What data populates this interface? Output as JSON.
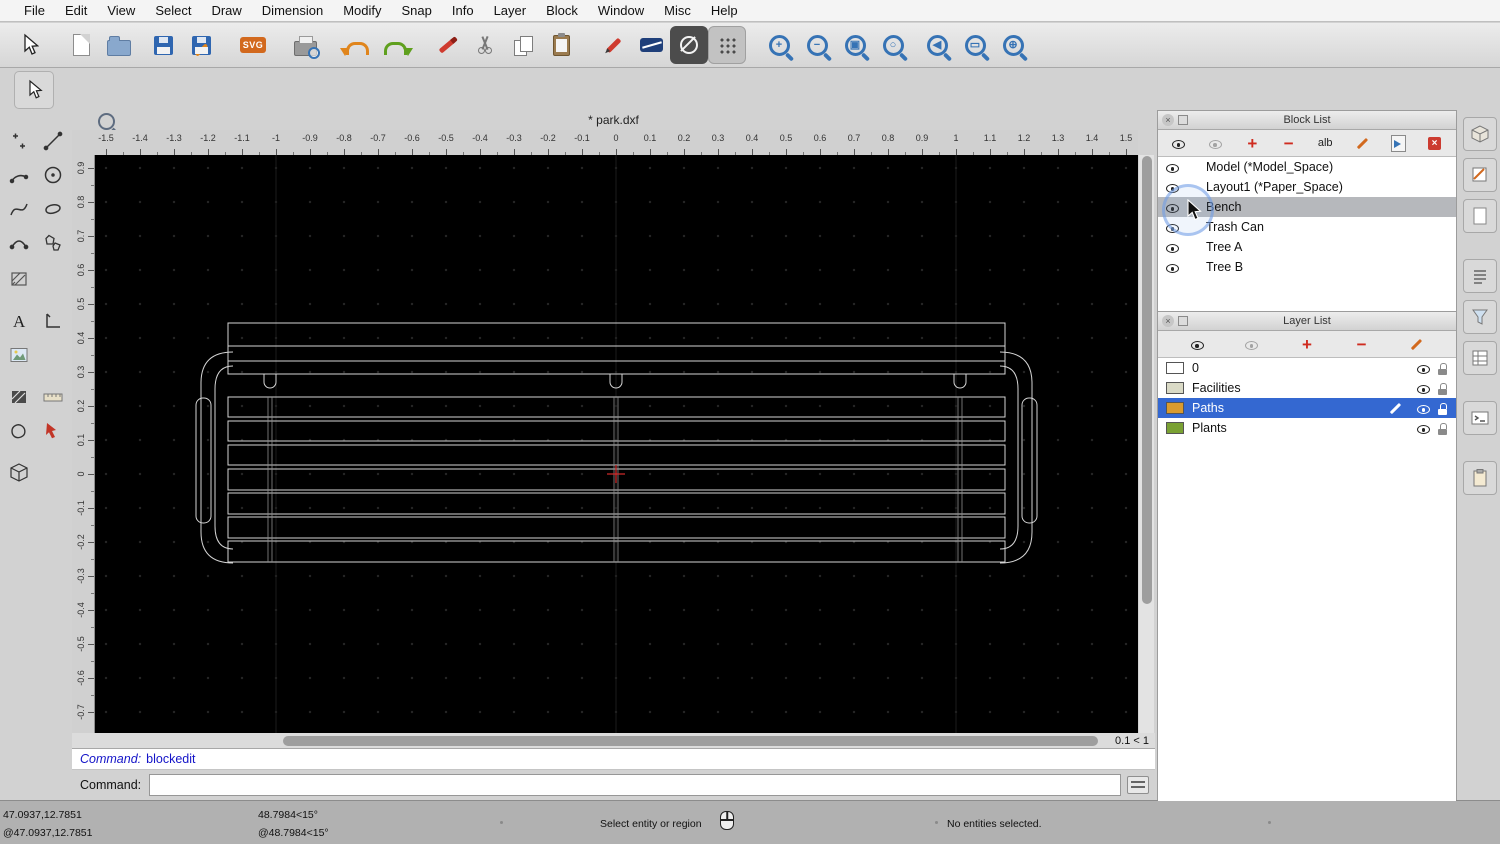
{
  "menu": {
    "items": [
      "File",
      "Edit",
      "View",
      "Select",
      "Draw",
      "Dimension",
      "Modify",
      "Snap",
      "Info",
      "Layer",
      "Block",
      "Window",
      "Misc",
      "Help"
    ]
  },
  "document": {
    "title": "* park.dxf"
  },
  "toolbar": {
    "icons": [
      "select-cursor",
      "new-file",
      "open-file",
      "save",
      "save-as",
      "svg-export",
      "print-preview",
      "undo",
      "redo",
      "erase",
      "cut",
      "copy",
      "paste",
      "pen-edit",
      "attributes",
      "draw-donut",
      "grid-toggle",
      "zoom-in",
      "zoom-out",
      "zoom-auto",
      "zoom-redraw",
      "zoom-previous",
      "zoom-window",
      "zoom-pan"
    ],
    "svg_icon_text": "SVG"
  },
  "left_palette": {
    "tools": [
      "points",
      "line",
      "arc",
      "circle",
      "spline",
      "ellipse",
      "polyline",
      "polygon",
      "hatch",
      "text",
      "dimension",
      "image",
      "pattern",
      "measure",
      "shape",
      "modify",
      "solid"
    ]
  },
  "canvas": {
    "h_ruler_labels": [
      "-1.5",
      "-1.4",
      "-1.3",
      "-1.2",
      "-1.1",
      "-1",
      "-0.9",
      "-0.8",
      "-0.7",
      "-0.6",
      "-0.5",
      "-0.4",
      "-0.3",
      "-0.2",
      "-0.1",
      "0",
      "0.1",
      "0.2",
      "0.3",
      "0.4",
      "0.5",
      "0.6",
      "0.7",
      "0.8",
      "0.9",
      "1",
      "1.1",
      "1.2",
      "1.3",
      "1.4",
      "1.5"
    ],
    "v_ruler_labels": [
      "0.9",
      "0.8",
      "0.7",
      "0.6",
      "0.5",
      "0.4",
      "0.3",
      "0.2",
      "0.1",
      "0",
      "-0.1",
      "-0.2",
      "-0.3",
      "-0.4",
      "-0.5",
      "-0.6",
      "-0.7"
    ],
    "zoom_indicator": "0.1 < 1"
  },
  "command_area": {
    "history_label": "Command:",
    "history_command": "blockedit",
    "prompt_label": "Command:",
    "input_value": ""
  },
  "status_bar": {
    "coord_absolute": "47.0937,12.7851",
    "coord_relative": "@47.0937,12.7851",
    "polar_absolute": "48.7984<15°",
    "polar_relative": "@48.7984<15°",
    "hint": "Select entity or region",
    "selection_status": "No entities selected."
  },
  "block_list": {
    "title": "Block List",
    "rename_label": "alb",
    "toolbar_icons": [
      "show-all-blocks",
      "hide-all-blocks",
      "add-block",
      "remove-block",
      "rename-block",
      "edit-block",
      "insert-block",
      "delete-all-blocks"
    ],
    "items": [
      {
        "label": "Model (*Model_Space)"
      },
      {
        "label": "Layout1 (*Paper_Space)"
      },
      {
        "label": "Bench"
      },
      {
        "label": "Trash Can"
      },
      {
        "label": "Tree A"
      },
      {
        "label": "Tree B"
      }
    ]
  },
  "layer_list": {
    "title": "Layer List",
    "toolbar_icons": [
      "show-all-layers",
      "hide-all-layers",
      "add-layer",
      "remove-layer",
      "edit-layer"
    ],
    "items": [
      {
        "name": "0",
        "color": "#ffffff"
      },
      {
        "name": "Facilities",
        "color": "#dadac6"
      },
      {
        "name": "Paths",
        "color": "#d99b2f",
        "selected": true
      },
      {
        "name": "Plants",
        "color": "#7aa133"
      }
    ]
  },
  "colors": {
    "selection_blue": "#3468d1",
    "canvas_background": "#000000",
    "cad_line": "#d4d4d4",
    "crosshair_red": "#cc2a2a"
  }
}
